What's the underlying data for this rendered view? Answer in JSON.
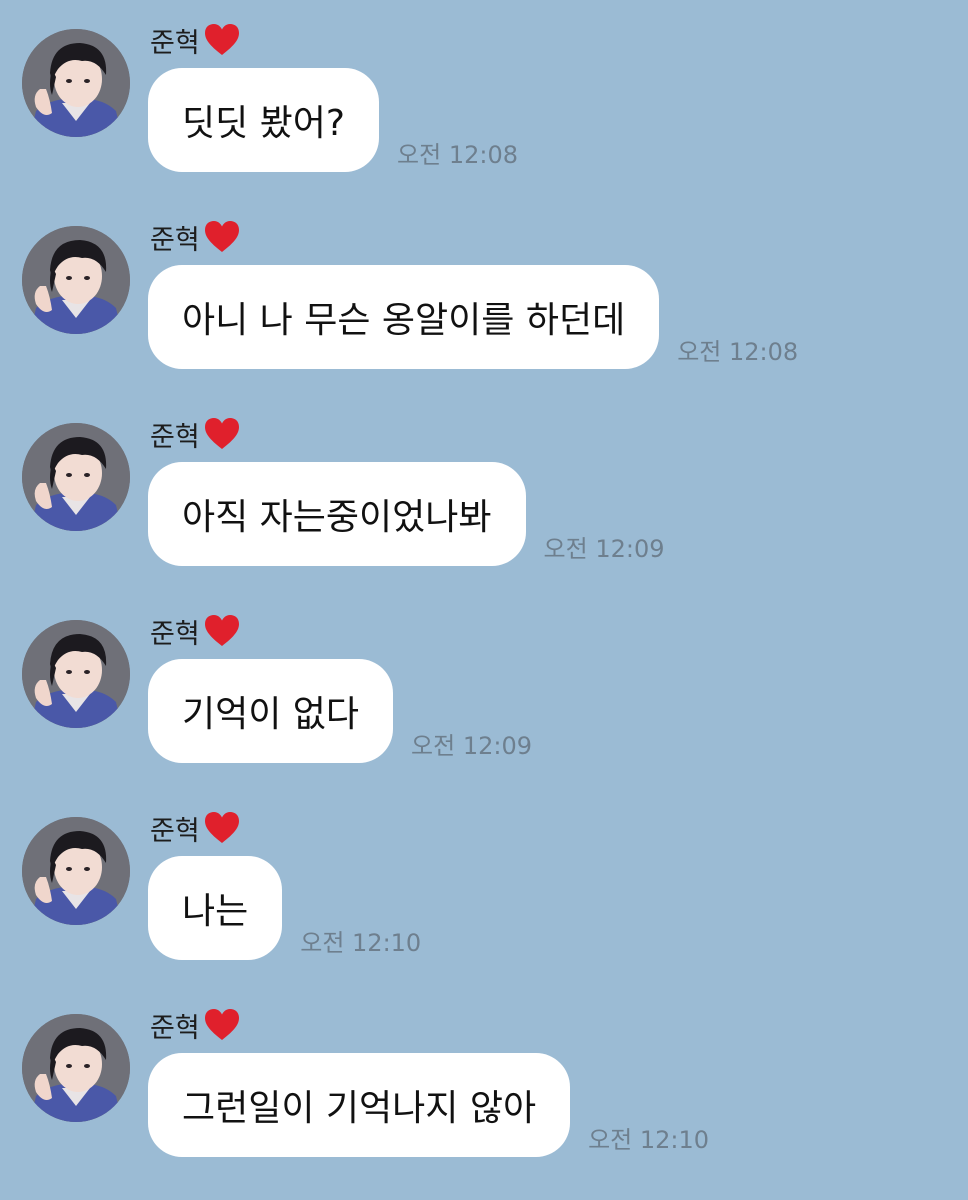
{
  "colors": {
    "background": "#9bbbd4",
    "bubble": "#ffffff",
    "timestamp": "#6e7f8e",
    "heart": "#e0202c"
  },
  "messages": [
    {
      "sender": "준혁",
      "sender_icon": "red-heart-icon",
      "text": "딧딧 봤어?",
      "time": "오전 12:08"
    },
    {
      "sender": "준혁",
      "sender_icon": "red-heart-icon",
      "text": "아니 나 무슨 옹알이를 하던데",
      "time": "오전 12:08"
    },
    {
      "sender": "준혁",
      "sender_icon": "red-heart-icon",
      "text": "아직 자는중이었나봐",
      "time": "오전 12:09"
    },
    {
      "sender": "준혁",
      "sender_icon": "red-heart-icon",
      "text": "기억이 없다",
      "time": "오전 12:09"
    },
    {
      "sender": "준혁",
      "sender_icon": "red-heart-icon",
      "text": "나는",
      "time": "오전 12:10"
    },
    {
      "sender": "준혁",
      "sender_icon": "red-heart-icon",
      "text": "그런일이 기억나지 않아",
      "time": "오전 12:10"
    }
  ]
}
